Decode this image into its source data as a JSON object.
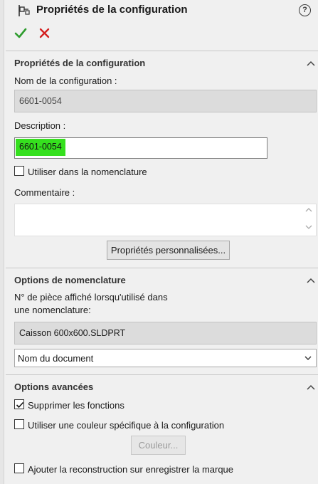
{
  "header": {
    "title": "Propriétés de la configuration",
    "help_symbol": "?",
    "icons": [
      "configuration-icon",
      "help-icon",
      "ok-checkmark-icon",
      "cancel-x-icon"
    ]
  },
  "colors": {
    "ok_green": "#2e9c2e",
    "cancel_red": "#d42020",
    "highlight_green": "#35e01e",
    "panel_bg": "#f0f0f0"
  },
  "config_section": {
    "title": "Propriétés de la configuration",
    "name_label": "Nom de la configuration :",
    "name_value": "6601-0054",
    "description_label": "Description :",
    "description_value": "6601-0054",
    "use_in_bom_label": "Utiliser dans la nomenclature",
    "use_in_bom_checked": false,
    "comment_label": "Commentaire :",
    "comment_value": "",
    "custom_props_button": "Propriétés personnalisées..."
  },
  "bom_section": {
    "title": "Options de nomenclature",
    "part_number_label_line1": "N° de pièce affiché lorsqu'utilisé dans",
    "part_number_label_line2": "une nomenclature:",
    "part_number_value": "Caisson 600x600.SLDPRT",
    "source_selected": "Nom du document"
  },
  "advanced_section": {
    "title": "Options avancées",
    "suppress_features_label": "Supprimer les fonctions",
    "suppress_features_checked": true,
    "use_config_color_label": "Utiliser une couleur spécifique à la configuration",
    "use_config_color_checked": false,
    "color_button": "Couleur...",
    "add_rebuild_label": "Ajouter la reconstruction sur enregistrer la marque",
    "add_rebuild_checked": false
  }
}
